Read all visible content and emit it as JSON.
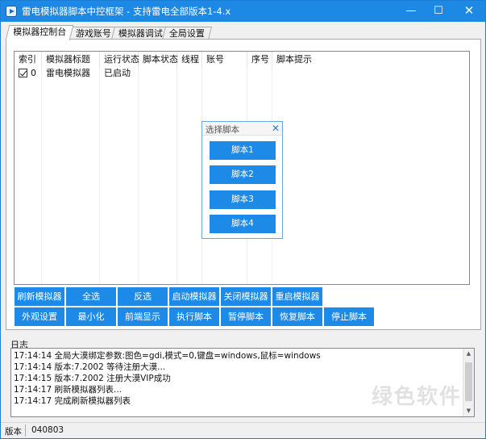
{
  "window": {
    "title": "雷电模拟器脚本中控框架 - 支持雷电全部版本1-4.x",
    "min_glyph": "—",
    "max_glyph": "☐",
    "close_glyph": "✕"
  },
  "tabs": [
    "模拟器控制台",
    "游戏账号",
    "模拟器调试",
    "全局设置"
  ],
  "list": {
    "columns": [
      "索引",
      "模拟器标题",
      "运行状态",
      "脚本状态",
      "线程",
      "账号",
      "序号",
      "脚本提示"
    ],
    "rows": [
      {
        "index": "0",
        "title": "雷电模拟器",
        "run_status": "已启动",
        "script_status": "",
        "thread": "",
        "account": "",
        "seq": "",
        "tip": "",
        "checked": true
      }
    ]
  },
  "dialog": {
    "title": "选择脚本",
    "close_glyph": "✕",
    "buttons": [
      "脚本1",
      "脚本2",
      "脚本3",
      "脚本4"
    ]
  },
  "toolbar": {
    "row1": [
      "刷新模拟器",
      "全选",
      "反选",
      "启动模拟器",
      "关闭模拟器",
      "重启模拟器"
    ],
    "row2": [
      "外观设置",
      "最小化",
      "前端显示",
      "执行脚本",
      "暂停脚本",
      "恢复脚本",
      "停止脚本"
    ]
  },
  "log": {
    "label": "日志",
    "lines": [
      "17:14:14 全局大漠绑定参数:图色=gdi,模式=0,键盘=windows,鼠标=windows",
      "17:14:14 版本:7.2002 等待注册大漠...",
      "17:14:15 版本:7.2002 注册大漠VIP成功",
      "17:14:17 刷新模拟器列表...",
      "17:14:17 完成刷新模拟器列表"
    ],
    "scroll_up_glyph": "▲",
    "scroll_down_glyph": "▼"
  },
  "statusbar": {
    "version_label": "版本",
    "version_value": "040803"
  },
  "watermark": "绿色软件",
  "colors": {
    "accent": "#1e88e5",
    "button_blue": "#1e8ae8"
  }
}
